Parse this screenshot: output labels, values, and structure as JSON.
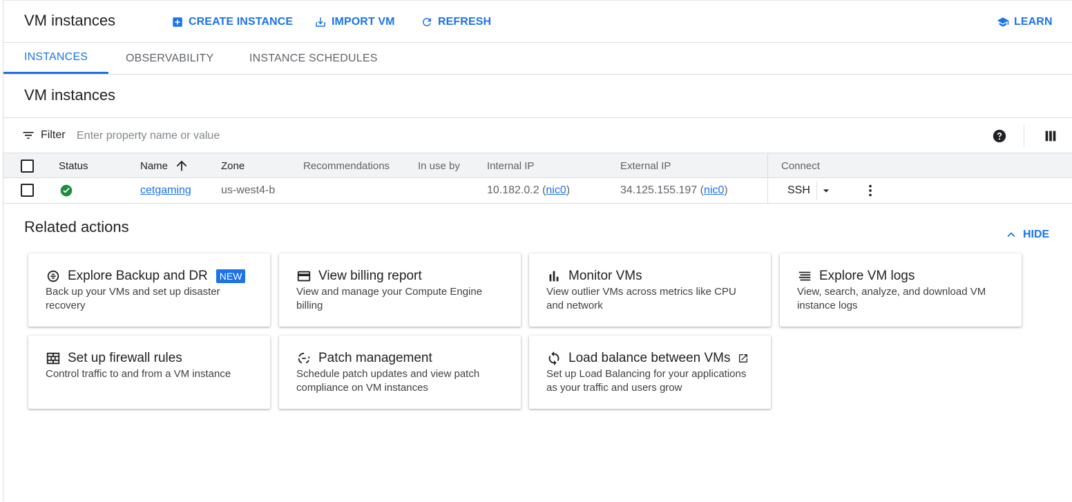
{
  "header": {
    "title": "VM instances",
    "actions": [
      {
        "label": "CREATE INSTANCE",
        "icon": "add-box-icon"
      },
      {
        "label": "IMPORT VM",
        "icon": "download-icon"
      },
      {
        "label": "REFRESH",
        "icon": "refresh-icon"
      }
    ],
    "learn_label": "LEARN"
  },
  "tabs": [
    "INSTANCES",
    "OBSERVABILITY",
    "INSTANCE SCHEDULES"
  ],
  "section_title": "VM instances",
  "filter": {
    "label": "Filter",
    "placeholder": "Enter property name or value"
  },
  "table": {
    "headers": {
      "status": "Status",
      "name": "Name",
      "zone": "Zone",
      "recommendations": "Recommendations",
      "in_use_by": "In use by",
      "internal_ip": "Internal IP",
      "external_ip": "External IP",
      "connect": "Connect"
    },
    "rows": [
      {
        "status": "running",
        "name": "cetgaming",
        "zone": "us-west4-b",
        "recommendations": "",
        "in_use_by": "",
        "internal_ip": "10.182.0.2",
        "internal_nic": "nic0",
        "external_ip": "34.125.155.197",
        "external_nic": "nic0",
        "connect": "SSH"
      }
    ]
  },
  "related": {
    "title": "Related actions",
    "hide_label": "HIDE",
    "cards": [
      {
        "title": "Explore Backup and DR",
        "badge": "NEW",
        "desc": "Back up your VMs and set up disaster recovery",
        "icon": "backup-icon"
      },
      {
        "title": "View billing report",
        "desc": "View and manage your Compute Engine billing",
        "icon": "billing-card-icon"
      },
      {
        "title": "Monitor VMs",
        "desc": "View outlier VMs across metrics like CPU and network",
        "icon": "bar-chart-icon"
      },
      {
        "title": "Explore VM logs",
        "desc": "View, search, analyze, and download VM instance logs",
        "icon": "logs-list-icon"
      },
      {
        "title": "Set up firewall rules",
        "desc": "Control traffic to and from a VM instance",
        "icon": "firewall-icon"
      },
      {
        "title": "Patch management",
        "desc": "Schedule patch updates and view patch compliance on VM instances",
        "icon": "patch-icon"
      },
      {
        "title": "Load balance between VMs",
        "desc": "Set up Load Balancing for your applications as your traffic and users grow",
        "icon": "sync-icon",
        "external": true
      }
    ]
  },
  "colors": {
    "accent": "#1a73e8",
    "success": "#1e8e3e"
  }
}
